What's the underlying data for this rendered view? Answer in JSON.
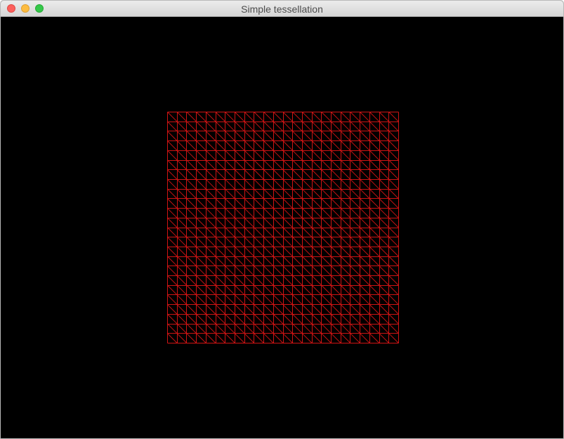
{
  "window": {
    "title": "Simple tessellation"
  },
  "render": {
    "background": "#000000",
    "wire_color": "#d01414",
    "grid_divisions": 24,
    "primitive": "triangle-wireframe"
  }
}
